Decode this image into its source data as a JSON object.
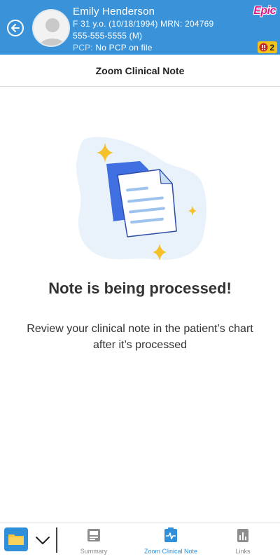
{
  "patient": {
    "name": "Emily Henderson",
    "demographics": "F 31 y.o. (10/18/1994) MRN: 204769",
    "phone": "555-555-5555 (M)",
    "pcp_label": "PCP:",
    "pcp_value": "No PCP on file",
    "alert_count": "2"
  },
  "brand": {
    "logo_text": "Epic"
  },
  "header": {
    "title": "Zoom Clinical Note"
  },
  "main": {
    "status_title": "Note is being processed!",
    "status_description": "Review your clinical note in the patient’s chart after it’s processed"
  },
  "bottom_bar": {
    "tabs": [
      {
        "label": "Summary",
        "icon": "summary-icon",
        "active": false
      },
      {
        "label": "Zoom Clinical Note",
        "icon": "activity-clipboard-icon",
        "active": true
      },
      {
        "label": "Links",
        "icon": "links-icon",
        "active": false
      }
    ]
  },
  "colors": {
    "header_bg": "#3a93d9",
    "accent": "#2f8fd8",
    "epic_brand": "#e5178a",
    "alert_badge": "#f3c21a",
    "star": "#f4c12b"
  }
}
